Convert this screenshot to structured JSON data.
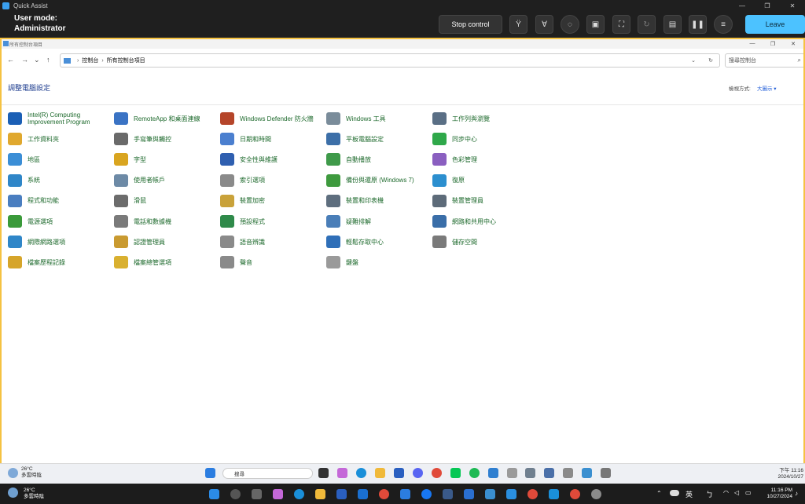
{
  "quick_assist": {
    "title": "Quick Assist",
    "user_mode_line1": "User mode:",
    "user_mode_line2": "Administrator",
    "stop_control": "Stop control",
    "leave": "Leave"
  },
  "control_panel": {
    "window_title": "所有控制台項目",
    "breadcrumb": [
      "控制台",
      "所有控制台項目"
    ],
    "search_placeholder": "搜尋控制台",
    "page_title": "調整電腦設定",
    "view_by_label": "檢視方式:",
    "view_by_value": "大圖示 ▾",
    "items": [
      {
        "label": "Intel(R) Computing Improvement Program",
        "icon": "intel-icon",
        "color": "#1b5fb5"
      },
      {
        "label": "RemoteApp 和桌面連線",
        "icon": "remote-desktop-icon",
        "color": "#3a73c4"
      },
      {
        "label": "Windows Defender 防火牆",
        "icon": "firewall-icon",
        "color": "#b5452a"
      },
      {
        "label": "Windows 工具",
        "icon": "tools-icon",
        "color": "#7a8c9a"
      },
      {
        "label": "工作列與瀏覽",
        "icon": "taskbar-icon",
        "color": "#5a6f85"
      },
      {
        "label": "工作資料夾",
        "icon": "work-folders-icon",
        "color": "#e0a82e"
      },
      {
        "label": "手寫筆與觸控",
        "icon": "pen-icon",
        "color": "#6a6a6a"
      },
      {
        "label": "日期和時間",
        "icon": "clock-icon",
        "color": "#4b7fcf"
      },
      {
        "label": "平板電腦設定",
        "icon": "tablet-icon",
        "color": "#3c6fa8"
      },
      {
        "label": "同步中心",
        "icon": "sync-icon",
        "color": "#2fa84a"
      },
      {
        "label": "地區",
        "icon": "globe-icon",
        "color": "#3b8ed6"
      },
      {
        "label": "字型",
        "icon": "font-icon",
        "color": "#d9a520"
      },
      {
        "label": "安全性與維護",
        "icon": "flag-icon",
        "color": "#2f5fb0"
      },
      {
        "label": "自動播放",
        "icon": "autoplay-icon",
        "color": "#3f9a4a"
      },
      {
        "label": "色彩管理",
        "icon": "color-icon",
        "color": "#8a5fc0"
      },
      {
        "label": "系統",
        "icon": "system-icon",
        "color": "#2f86c8"
      },
      {
        "label": "使用者帳戶",
        "icon": "users-icon",
        "color": "#6d8aa6"
      },
      {
        "label": "索引選項",
        "icon": "index-icon",
        "color": "#8a8a8a"
      },
      {
        "label": "備份與還原 (Windows 7)",
        "icon": "backup-icon",
        "color": "#3e9a3e"
      },
      {
        "label": "復原",
        "icon": "recovery-icon",
        "color": "#2c8fcf"
      },
      {
        "label": "程式和功能",
        "icon": "programs-icon",
        "color": "#4a7ec0"
      },
      {
        "label": "滑鼠",
        "icon": "mouse-icon",
        "color": "#6c6c6c"
      },
      {
        "label": "裝置加密",
        "icon": "key-icon",
        "color": "#c9a23a"
      },
      {
        "label": "裝置和印表機",
        "icon": "printer-icon",
        "color": "#5e6e7e"
      },
      {
        "label": "裝置管理員",
        "icon": "device-manager-icon",
        "color": "#5d6b79"
      },
      {
        "label": "電源選項",
        "icon": "power-icon",
        "color": "#3a9a3a"
      },
      {
        "label": "電話和數據機",
        "icon": "phone-icon",
        "color": "#7a7a7a"
      },
      {
        "label": "預設程式",
        "icon": "default-programs-icon",
        "color": "#2f8a4a"
      },
      {
        "label": "疑難排解",
        "icon": "troubleshoot-icon",
        "color": "#4a7eb8"
      },
      {
        "label": "網路和共用中心",
        "icon": "network-icon",
        "color": "#3a6ea8"
      },
      {
        "label": "網際網路選項",
        "icon": "internet-icon",
        "color": "#2f86c8"
      },
      {
        "label": "認證管理員",
        "icon": "credential-icon",
        "color": "#c99a30"
      },
      {
        "label": "語音辨識",
        "icon": "microphone-icon",
        "color": "#8a8a8a"
      },
      {
        "label": "輕鬆存取中心",
        "icon": "accessibility-icon",
        "color": "#2f6fb8"
      },
      {
        "label": "儲存空間",
        "icon": "storage-icon",
        "color": "#7a7a7a"
      },
      {
        "label": "檔案歷程記錄",
        "icon": "file-history-icon",
        "color": "#d6a52a"
      },
      {
        "label": "檔案總管選項",
        "icon": "folder-options-icon",
        "color": "#d9b030"
      },
      {
        "label": "聲音",
        "icon": "speaker-icon",
        "color": "#8a8a8a"
      },
      {
        "label": "鍵盤",
        "icon": "keyboard-icon",
        "color": "#9a9a9a"
      }
    ]
  },
  "remote_taskbar": {
    "weather_temp": "26°C",
    "weather_desc": "多雲時陰",
    "search_text": "搜尋",
    "time": "下午 11:16",
    "date": "2024/10/27"
  },
  "local_taskbar": {
    "weather_temp": "26°C",
    "weather_desc": "多雲時陰",
    "lang": "英",
    "time": "11:16 PM",
    "date": "10/27/2024"
  }
}
